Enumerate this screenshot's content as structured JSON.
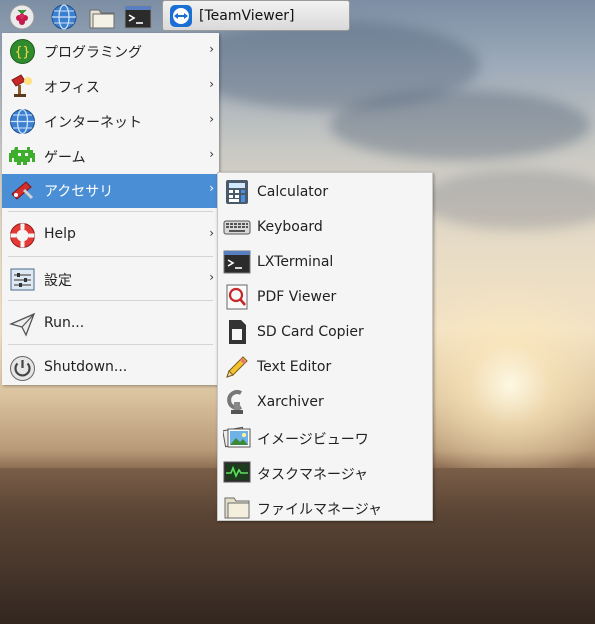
{
  "taskbar": {
    "items": [
      {
        "icon": "raspberry-icon"
      },
      {
        "icon": "globe-icon"
      },
      {
        "icon": "folder-icon"
      },
      {
        "icon": "terminal-icon"
      }
    ],
    "app_button": {
      "label": "[TeamViewer]",
      "icon": "teamviewer-icon"
    }
  },
  "main_menu": {
    "items": [
      {
        "label": "プログラミング",
        "icon": "programming-icon"
      },
      {
        "label": "オフィス",
        "icon": "office-icon"
      },
      {
        "label": "インターネット",
        "icon": "internet-icon"
      },
      {
        "label": "ゲーム",
        "icon": "games-icon"
      },
      {
        "label": "アクセサリ",
        "icon": "accessories-icon"
      },
      {
        "label": "Help",
        "icon": "help-icon"
      },
      {
        "label": "設定",
        "icon": "settings-icon"
      },
      {
        "label": "Run...",
        "icon": "run-icon"
      },
      {
        "label": "Shutdown...",
        "icon": "shutdown-icon"
      }
    ],
    "arrow": "›"
  },
  "sub_menu": {
    "items": [
      {
        "label": "Calculator",
        "icon": "calculator-icon"
      },
      {
        "label": "Keyboard",
        "icon": "keyboard-icon"
      },
      {
        "label": "LXTerminal",
        "icon": "terminal-icon"
      },
      {
        "label": "PDF Viewer",
        "icon": "pdf-viewer-icon"
      },
      {
        "label": "SD Card Copier",
        "icon": "sd-card-icon"
      },
      {
        "label": "Text Editor",
        "icon": "text-editor-icon"
      },
      {
        "label": "Xarchiver",
        "icon": "archiver-icon"
      },
      {
        "label": "イメージビューワ",
        "icon": "image-viewer-icon"
      },
      {
        "label": "タスクマネージャ",
        "icon": "task-manager-icon"
      },
      {
        "label": "ファイルマネージャ",
        "icon": "file-manager-icon"
      }
    ]
  },
  "colors": {
    "highlight": "#4a8fd6",
    "menu_bg": "#f5f5f5"
  }
}
